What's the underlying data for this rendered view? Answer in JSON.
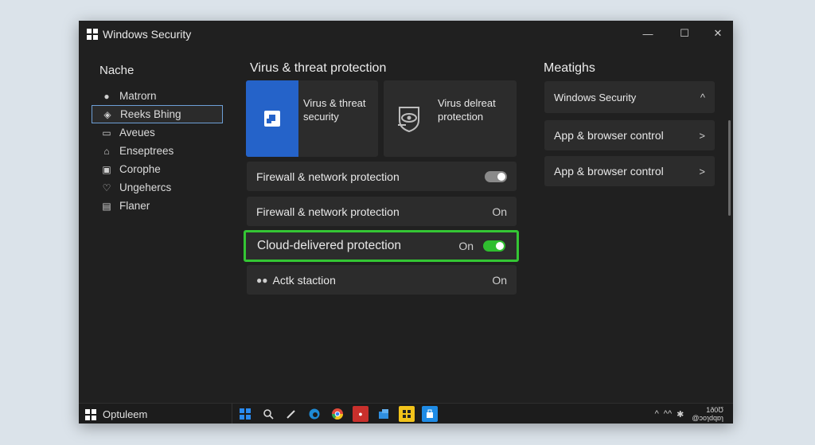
{
  "window": {
    "title": "Windows Security",
    "controls": {
      "minimize": "—",
      "maximize": "☐",
      "close": "✕"
    }
  },
  "sidebar": {
    "heading": "Nache",
    "items": [
      {
        "label": "Matrorn",
        "icon": "lock-icon",
        "glyph": "🔒"
      },
      {
        "label": "Reeks Bhing",
        "icon": "shield-diamond-icon",
        "glyph": "◈",
        "selected": true
      },
      {
        "label": "Aveues",
        "icon": "window-icon",
        "glyph": "▭"
      },
      {
        "label": "Enseptrees",
        "icon": "home-icon",
        "glyph": "⌂"
      },
      {
        "label": "Corophe",
        "icon": "monitor-icon",
        "glyph": "▣"
      },
      {
        "label": "Ungehercs",
        "icon": "heart-icon",
        "glyph": "♡"
      },
      {
        "label": "Flaner",
        "icon": "history-icon",
        "glyph": "▤"
      }
    ]
  },
  "main": {
    "heading": "Virus & threat protection",
    "tiles": [
      {
        "label": "Virus & threat security",
        "icon": "virus-shield-icon",
        "accent": "#2563c9"
      },
      {
        "label": "Virus delreat protection",
        "icon": "eye-shield-icon",
        "accent": "#2c2c2c"
      }
    ],
    "rows": [
      {
        "label": "Firewall & network protection",
        "state": "",
        "toggle": "gray"
      },
      {
        "label": "Firewall & network protection",
        "state": "On",
        "toggle": "none"
      },
      {
        "label": "Cloud-delivered protection",
        "state": "On",
        "toggle": "green"
      },
      {
        "label": "Actk staction",
        "state": "On",
        "toggle": "none",
        "icon": "people-icon"
      }
    ]
  },
  "right": {
    "heading": "Meatighs",
    "items": [
      {
        "label": "Windows Security",
        "chevron": "^"
      },
      {
        "label": "App & browser control",
        "chevron": ">"
      },
      {
        "label": "App & browser control",
        "chevron": ">"
      }
    ]
  },
  "taskbar": {
    "start_label": "Optuleem",
    "apps": [
      {
        "name": "windows-start-icon",
        "color": "#2a8bf2"
      },
      {
        "name": "search-icon",
        "color": "#d9d9d9"
      },
      {
        "name": "pen-icon",
        "color": "#d9d9d9"
      },
      {
        "name": "edge-browser-icon",
        "color": "#1e8bd6"
      },
      {
        "name": "chrome-icon",
        "color": "#e24a3b"
      },
      {
        "name": "red-app-icon",
        "color": "#c9302c"
      },
      {
        "name": "blue-app-icon",
        "color": "#2f8fe0"
      },
      {
        "name": "yellow-app-icon",
        "color": "#f2c31a"
      },
      {
        "name": "store-icon",
        "color": "#1f8ce6"
      }
    ],
    "tray": {
      "up_arrow": "^",
      "wifi": "^^",
      "settings": "✱"
    },
    "clock": {
      "time": "1ð0Ʊ",
      "date": "@ɔoɿdqɒɿ"
    }
  },
  "colors": {
    "window_bg": "#202020",
    "card_bg": "#2c2c2c",
    "accent_blue": "#2563c9",
    "highlight_green": "#34c634",
    "toggle_green": "#2fbe2f"
  }
}
